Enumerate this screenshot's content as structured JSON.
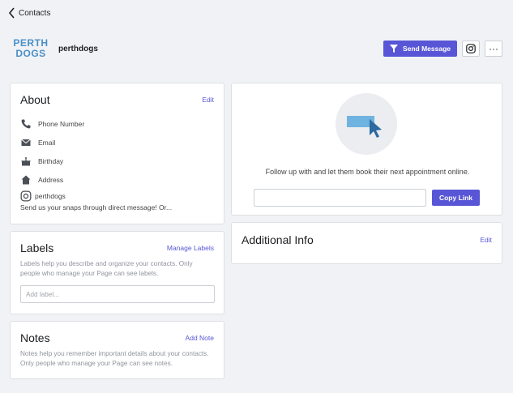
{
  "nav": {
    "back_label": "Contacts"
  },
  "header": {
    "logo_line1": "PERTH",
    "logo_line2": "DOGS",
    "page_name": "perthdogs",
    "send_message_label": "Send Message",
    "more_label": "···"
  },
  "about": {
    "title": "About",
    "edit_label": "Edit",
    "rows": [
      {
        "icon": "phone-icon",
        "label": "Phone Number"
      },
      {
        "icon": "email-icon",
        "label": "Email"
      },
      {
        "icon": "birthday-cake-icon",
        "label": "Birthday"
      },
      {
        "icon": "home-icon",
        "label": "Address"
      }
    ],
    "instagram_handle": "perthdogs",
    "instagram_bio": "Send us your snaps through direct message! Or..."
  },
  "labels": {
    "title": "Labels",
    "manage_label": "Manage Labels",
    "description": "Labels help you describe and organize your contacts. Only people who manage your Page can see labels.",
    "input_placeholder": "Add label...",
    "input_value": ""
  },
  "notes": {
    "title": "Notes",
    "add_label": "Add Note",
    "description": "Notes help you remember important details about your contacts. Only people who manage your Page can see notes."
  },
  "promo": {
    "text": "Follow up with and let them book their next appointment online.",
    "link_value": "",
    "copy_label": "Copy Link"
  },
  "additional_info": {
    "title": "Additional Info",
    "edit_label": "Edit"
  },
  "colors": {
    "accent": "#5856d6",
    "logo_blue": "#4a90c8",
    "background": "#f0f2f5",
    "illustration_blue": "#6fb3e0",
    "illustration_dark": "#2c6aa0"
  }
}
